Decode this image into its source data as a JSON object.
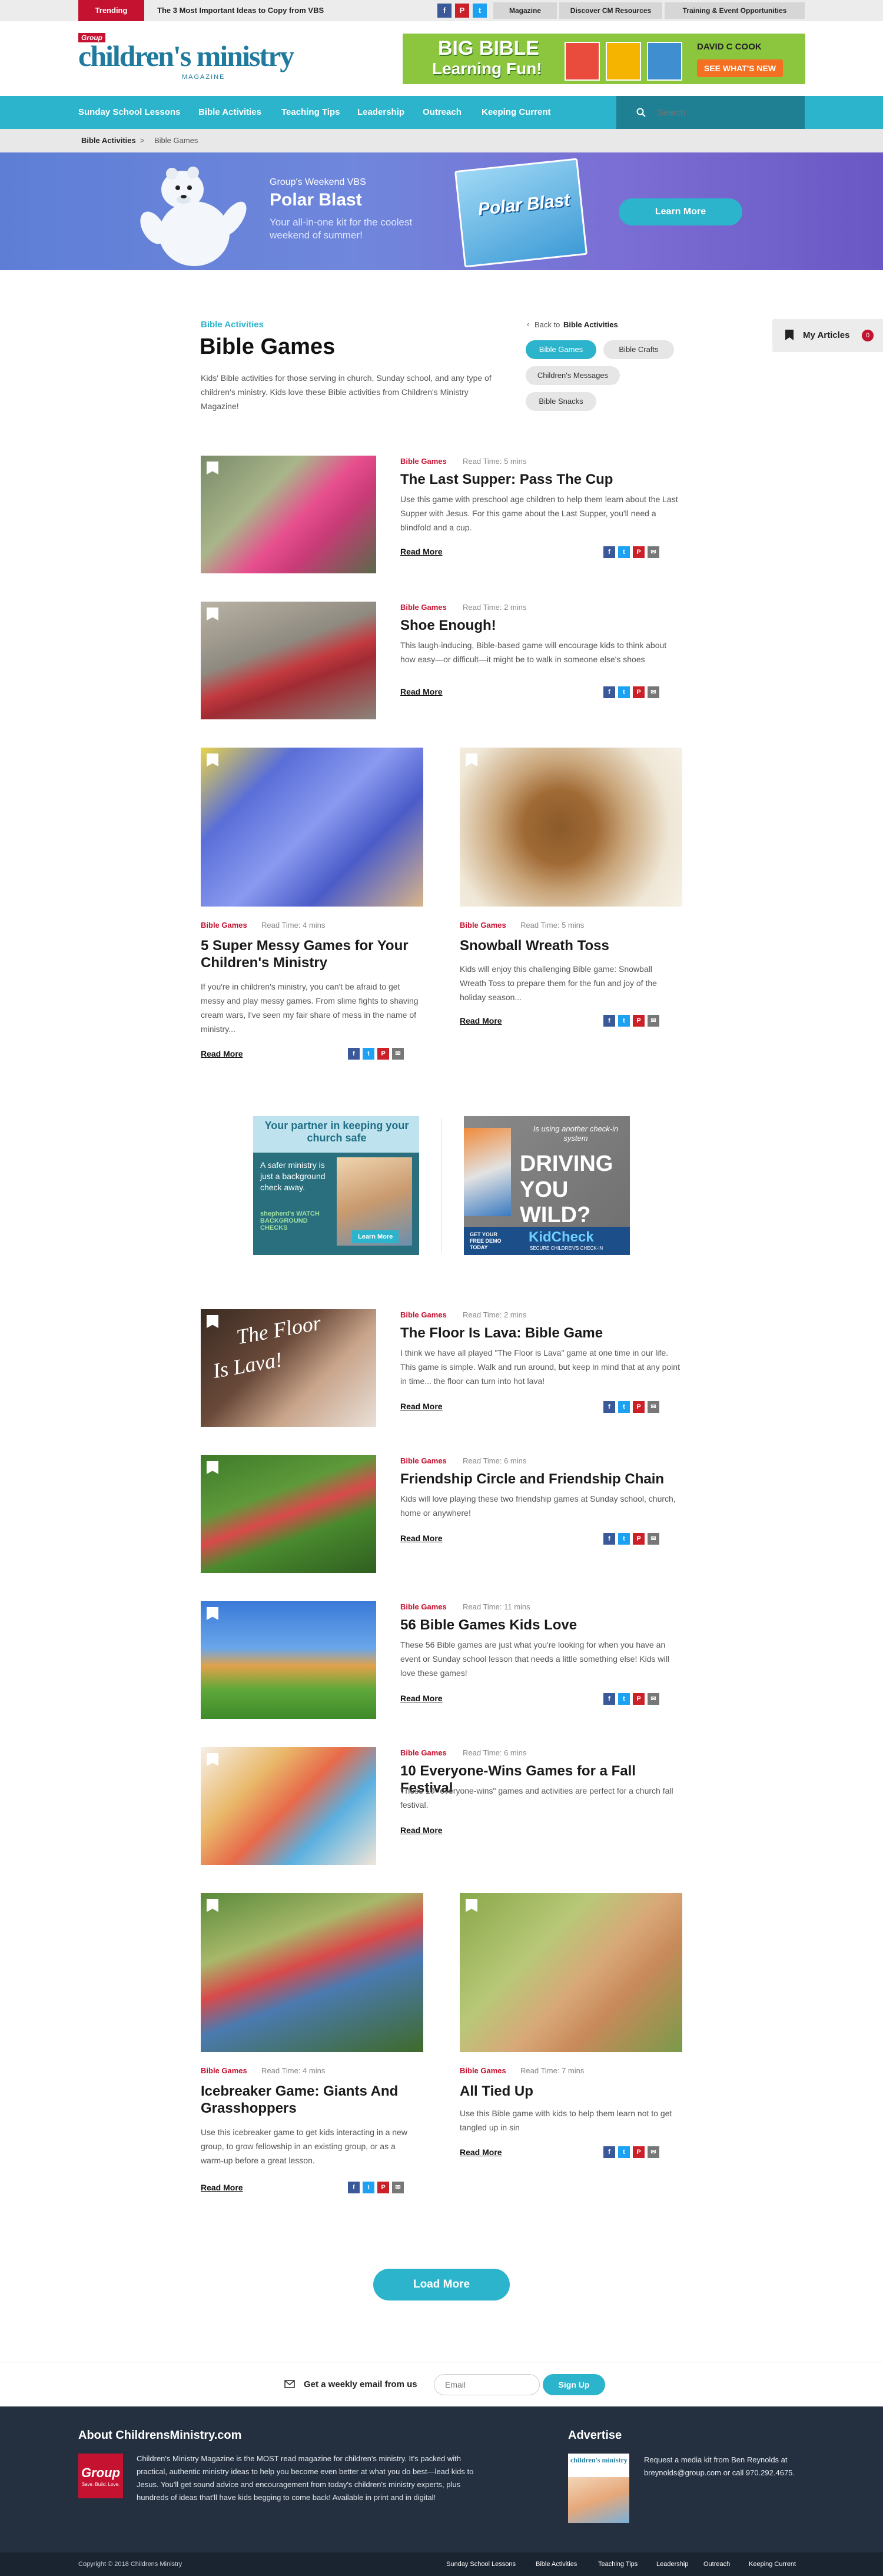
{
  "topbar": {
    "trending_label": "Trending",
    "trending_text": "The 3 Most Important Ideas to Copy from VBS",
    "social": [
      "f",
      "P",
      "t"
    ],
    "links": [
      "Magazine",
      "Discover CM Resources",
      "Training & Event Opportunities"
    ]
  },
  "header": {
    "logo_group": "Group",
    "logo_title": "children's ministry",
    "logo_sub": "MAGAZINE",
    "ad_title_1": "BIG BIBLE",
    "ad_title_2": "Learning Fun!",
    "ad_brand": "DAVID C COOK",
    "ad_cta": "SEE WHAT'S NEW"
  },
  "nav": {
    "items": [
      "Sunday School Lessons",
      "Bible Activities",
      "Teaching Tips",
      "Leadership",
      "Outreach",
      "Keeping Current"
    ],
    "search_placeholder": "Search"
  },
  "breadcrumb": {
    "parent": "Bible Activities",
    "separator": ">",
    "current": "Bible Games"
  },
  "hero": {
    "kicker": "Group's Weekend VBS",
    "title": "Polar Blast",
    "desc": "Your all-in-one kit for the coolest weekend of summer!",
    "box_label": "Polar Blast",
    "cta": "Learn More"
  },
  "page": {
    "category": "Bible Activities",
    "title": "Bible Games",
    "intro": "Kids' Bible activities for those serving in church, Sunday school, and any type of children's ministry. Kids love these Bible activities from Children's Ministry Magazine!",
    "back_prefix": "Back to",
    "back_link": "Bible Activities",
    "filters": [
      "Bible Games",
      "Bible Crafts",
      "Children's Messages",
      "Bible Snacks"
    ],
    "my_articles": "My Articles",
    "my_articles_count": "0"
  },
  "articles": [
    {
      "cat": "Bible Games",
      "time": "Read Time: 5 mins",
      "title": "The Last Supper: Pass The Cup",
      "ex": "Use this game with preschool age children to help them learn about the Last Supper with Jesus. For this game about the Last Supper, you'll need a blindfold and a cup.",
      "more": "Read More"
    },
    {
      "cat": "Bible Games",
      "time": "Read Time: 2 mins",
      "title": "Shoe Enough!",
      "ex": "This laugh-inducing, Bible-based game will encourage kids to think about how easy—or difficult—it might be to walk in someone else's shoes",
      "more": "Read More"
    },
    {
      "cat": "Bible Games",
      "time": "Read Time: 4 mins",
      "title": "5 Super Messy Games for Your Children's Ministry",
      "ex": "If you're in children's ministry, you can't be afraid to get messy and play messy games. From slime fights to shaving cream wars, I've seen my fair share of mess in the name of ministry...",
      "more": "Read More"
    },
    {
      "cat": "Bible Games",
      "time": "Read Time: 5 mins",
      "title": "Snowball Wreath Toss",
      "ex": "Kids will enjoy this challenging Bible game: Snowball Wreath Toss to prepare them for the fun and joy of the holiday season...",
      "more": "Read More"
    },
    {
      "cat": "Bible Games",
      "time": "Read Time: 2 mins",
      "title": "The Floor Is Lava: Bible Game",
      "ex": "I think we have all played \"The Floor is Lava\" game at one time in our life. This game is simple. Walk and run around, but keep in mind that at any point in time... the floor can turn into hot lava!",
      "more": "Read More",
      "img_text_1": "The Floor",
      "img_text_2": "Is Lava!"
    },
    {
      "cat": "Bible Games",
      "time": "Read Time: 6 mins",
      "title": "Friendship Circle and Friendship Chain",
      "ex": "Kids will love playing these two friendship games at Sunday school, church, home or anywhere!",
      "more": "Read More"
    },
    {
      "cat": "Bible Games",
      "time": "Read Time: 11 mins",
      "title": "56 Bible Games Kids Love",
      "ex": "These 56 Bible games are just what you're looking for when you have an event or Sunday school lesson that needs a little something else! Kids will love these games!",
      "more": "Read More"
    },
    {
      "cat": "Bible Games",
      "time": "Read Time: 6 mins",
      "title": "10 Everyone-Wins Games for a Fall Festival",
      "ex": "These 10 \"everyone-wins\" games and activities are perfect for a church fall festival.",
      "more": "Read More"
    },
    {
      "cat": "Bible Games",
      "time": "Read Time: 4 mins",
      "title": "Icebreaker Game: Giants And Grasshoppers",
      "ex": "Use this icebreaker game to get kids interacting in a new group, to grow fellowship in an existing group, or as a warm-up before a great lesson.",
      "more": "Read More"
    },
    {
      "cat": "Bible Games",
      "time": "Read Time: 7 mins",
      "title": "All Tied Up",
      "ex": "Use this Bible game with kids to help them learn not to get tangled up in sin",
      "more": "Read More"
    }
  ],
  "share_icons": [
    "f",
    "t",
    "P",
    "✉"
  ],
  "ads": {
    "left_title": "Your partner in keeping your church safe",
    "left_body": "A safer ministry is just a background check away.",
    "left_brand": "shepherd's WATCH BACKGROUND CHECKS",
    "left_cta": "Learn More",
    "right_top": "Is using another check-in system",
    "right_big_1": "DRIVING",
    "right_big_2": "YOU WILD?",
    "right_small": "GET YOUR FREE DEMO TODAY",
    "right_brand": "KidCheck",
    "right_tag": "SECURE CHILDREN'S CHECK-IN"
  },
  "load_more": "Load More",
  "newsletter": {
    "label": "Get a weekly email from us",
    "placeholder": "Email",
    "button": "Sign Up"
  },
  "footer": {
    "about_title": "About ChildrensMinistry.com",
    "about_text": "Children's Ministry Magazine is the MOST read magazine for children's ministry. It's packed with practical, authentic ministry ideas to help you become even better at what you do best—lead kids to Jesus. You'll get sound advice and encouragement from today's children's ministry experts, plus hundreds of ideas that'll have kids begging to come back! Available in print and in digital!",
    "group_logo": "Group",
    "group_tag": "Save. Build. Love.",
    "advertise_title": "Advertise",
    "advertise_text": "Request a media kit from Ben Reynolds at breynolds@group.com or call 970.292.4675.",
    "mag_label": "children's ministry",
    "copyright": "Copyright © 2018 Childrens Ministry",
    "links": [
      "Sunday School Lessons",
      "Bible Activities",
      "Teaching Tips",
      "Leadership",
      "Outreach",
      "Keeping Current"
    ]
  },
  "colors": {
    "accent": "#2bb4cc",
    "brand_red": "#c41230",
    "footer_bg": "#243040"
  }
}
